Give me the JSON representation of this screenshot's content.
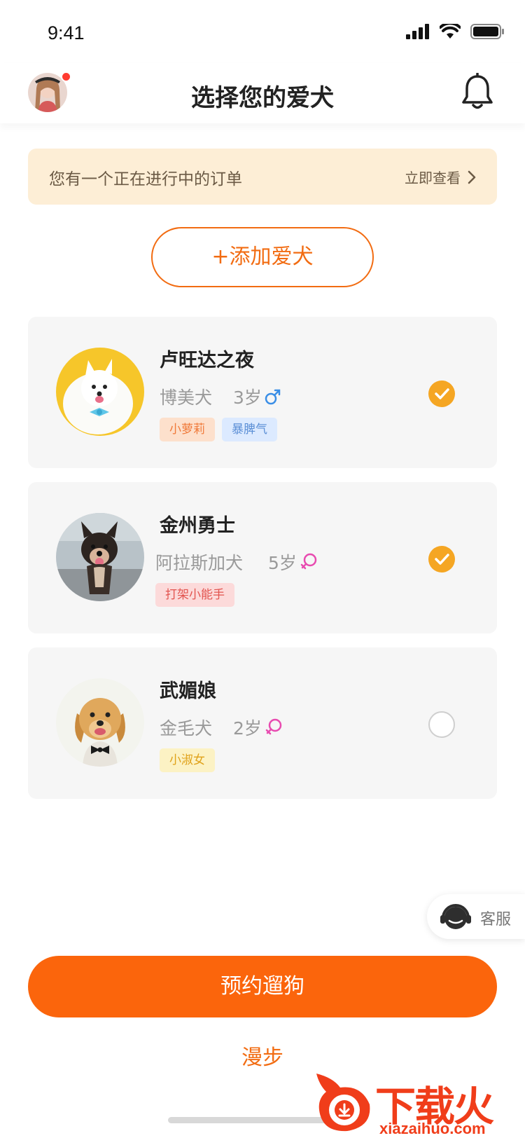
{
  "status_bar": {
    "time": "9:41"
  },
  "header": {
    "title": "选择您的爱犬"
  },
  "banner": {
    "text": "您有一个正在进行中的订单",
    "link_label": "立即查看"
  },
  "add_button": {
    "label": "+添加爱犬"
  },
  "dogs": [
    {
      "name": "卢旺达之夜",
      "breed": "博美犬",
      "age": "3岁",
      "gender": "male",
      "selected": true,
      "tags": [
        {
          "label": "小萝莉",
          "bg": "#fde0cc",
          "fg": "#f07a3a"
        },
        {
          "label": "暴脾气",
          "bg": "#dceaff",
          "fg": "#5b8fd6"
        }
      ]
    },
    {
      "name": "金州勇士",
      "breed": "阿拉斯加犬",
      "age": "5岁",
      "gender": "female",
      "selected": true,
      "tags": [
        {
          "label": "打架小能手",
          "bg": "#fcdada",
          "fg": "#e2544f"
        }
      ]
    },
    {
      "name": "武媚娘",
      "breed": "金毛犬",
      "age": "2岁",
      "gender": "female",
      "selected": false,
      "tags": [
        {
          "label": "小淑女",
          "bg": "#fcf2c4",
          "fg": "#e0a21a"
        }
      ]
    }
  ],
  "service": {
    "label": "客服"
  },
  "primary_button": {
    "label": "预约遛狗"
  },
  "secondary_link": {
    "label": "漫步"
  },
  "watermark": {
    "text": "下载火",
    "sub": "xiazaihuo.com"
  },
  "colors": {
    "accent": "#fb650c",
    "check": "#f5a623",
    "male": "#3a8ee6",
    "female": "#e84bb0"
  }
}
